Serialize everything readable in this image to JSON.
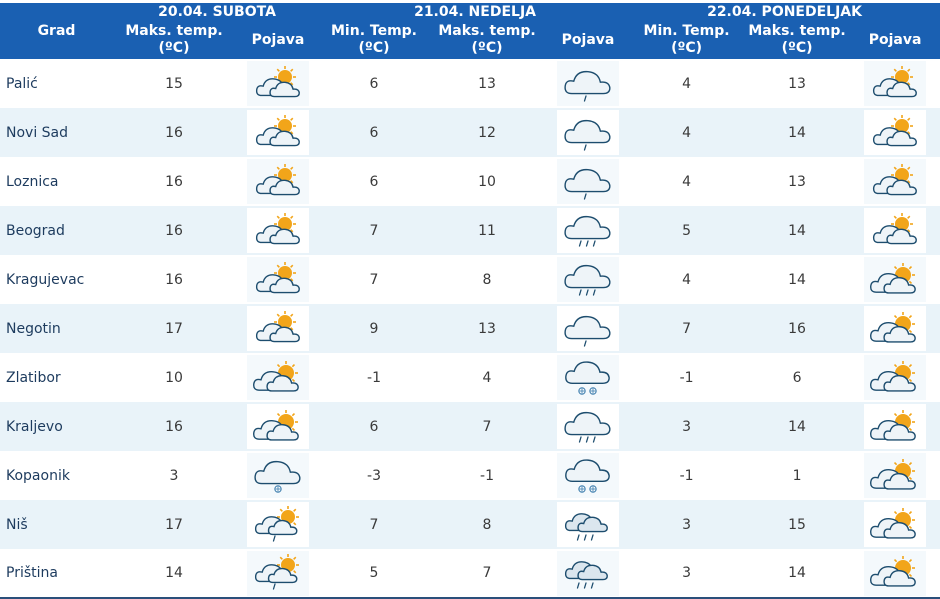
{
  "header": {
    "grad": "Grad",
    "days": [
      "20.04. SUBOTA",
      "21.04. NEDELJA",
      "22.04. PONEDELJAK"
    ],
    "col_max": "Maks. temp. (ºC)",
    "col_min": "Min. Temp. (ºC)",
    "col_pojava": "Pojava"
  },
  "rows": [
    {
      "city": "Palić",
      "d1max": "15",
      "d1icon": "partly-cloudy-icon",
      "d2min": "6",
      "d2max": "13",
      "d2icon": "cloud-light-rain-icon",
      "d3min": "4",
      "d3max": "13",
      "d3icon": "partly-cloudy-icon"
    },
    {
      "city": "Novi Sad",
      "d1max": "16",
      "d1icon": "partly-cloudy-icon",
      "d2min": "6",
      "d2max": "12",
      "d2icon": "cloud-light-rain-icon",
      "d3min": "4",
      "d3max": "14",
      "d3icon": "partly-cloudy-icon"
    },
    {
      "city": "Loznica",
      "d1max": "16",
      "d1icon": "partly-cloudy-icon",
      "d2min": "6",
      "d2max": "10",
      "d2icon": "cloud-light-rain-icon",
      "d3min": "4",
      "d3max": "13",
      "d3icon": "partly-cloudy-icon"
    },
    {
      "city": "Beograd",
      "d1max": "16",
      "d1icon": "partly-cloudy-icon",
      "d2min": "7",
      "d2max": "11",
      "d2icon": "cloud-rain-icon",
      "d3min": "5",
      "d3max": "14",
      "d3icon": "partly-cloudy-icon"
    },
    {
      "city": "Kragujevac",
      "d1max": "16",
      "d1icon": "partly-cloudy-icon",
      "d2min": "7",
      "d2max": "8",
      "d2icon": "cloud-rain-icon",
      "d3min": "4",
      "d3max": "14",
      "d3icon": "mostly-cloudy-icon"
    },
    {
      "city": "Negotin",
      "d1max": "17",
      "d1icon": "partly-cloudy-icon",
      "d2min": "9",
      "d2max": "13",
      "d2icon": "cloud-light-rain-icon",
      "d3min": "7",
      "d3max": "16",
      "d3icon": "mostly-cloudy-icon"
    },
    {
      "city": "Zlatibor",
      "d1max": "10",
      "d1icon": "mostly-cloudy-icon",
      "d2min": "-1",
      "d2max": "4",
      "d2icon": "cloud-snow-icon",
      "d3min": "-1",
      "d3max": "6",
      "d3icon": "mostly-cloudy-icon"
    },
    {
      "city": "Kraljevo",
      "d1max": "16",
      "d1icon": "mostly-cloudy-icon",
      "d2min": "6",
      "d2max": "7",
      "d2icon": "cloud-rain-icon",
      "d3min": "3",
      "d3max": "14",
      "d3icon": "mostly-cloudy-icon"
    },
    {
      "city": "Kopaonik",
      "d1max": "3",
      "d1icon": "cloud-light-snow-icon",
      "d2min": "-3",
      "d2max": "-1",
      "d2icon": "cloud-snow-icon",
      "d3min": "-1",
      "d3max": "1",
      "d3icon": "mostly-cloudy-icon"
    },
    {
      "city": "Niš",
      "d1max": "17",
      "d1icon": "sun-cloud-shower-icon",
      "d2min": "7",
      "d2max": "8",
      "d2icon": "dark-cloud-rain-icon",
      "d3min": "3",
      "d3max": "15",
      "d3icon": "mostly-cloudy-icon"
    },
    {
      "city": "Priština",
      "d1max": "14",
      "d1icon": "sun-cloud-shower-icon",
      "d2min": "5",
      "d2max": "7",
      "d2icon": "dark-cloud-rain-icon",
      "d3min": "3",
      "d3max": "14",
      "d3icon": "mostly-cloudy-icon"
    }
  ],
  "colors": {
    "header_bg": "#1a60b2",
    "row_alt": "#e9f3f9",
    "cloud_fill": "#eef4f8",
    "cloud_stroke": "#1d4d6e",
    "sun": "#f2a51a"
  }
}
